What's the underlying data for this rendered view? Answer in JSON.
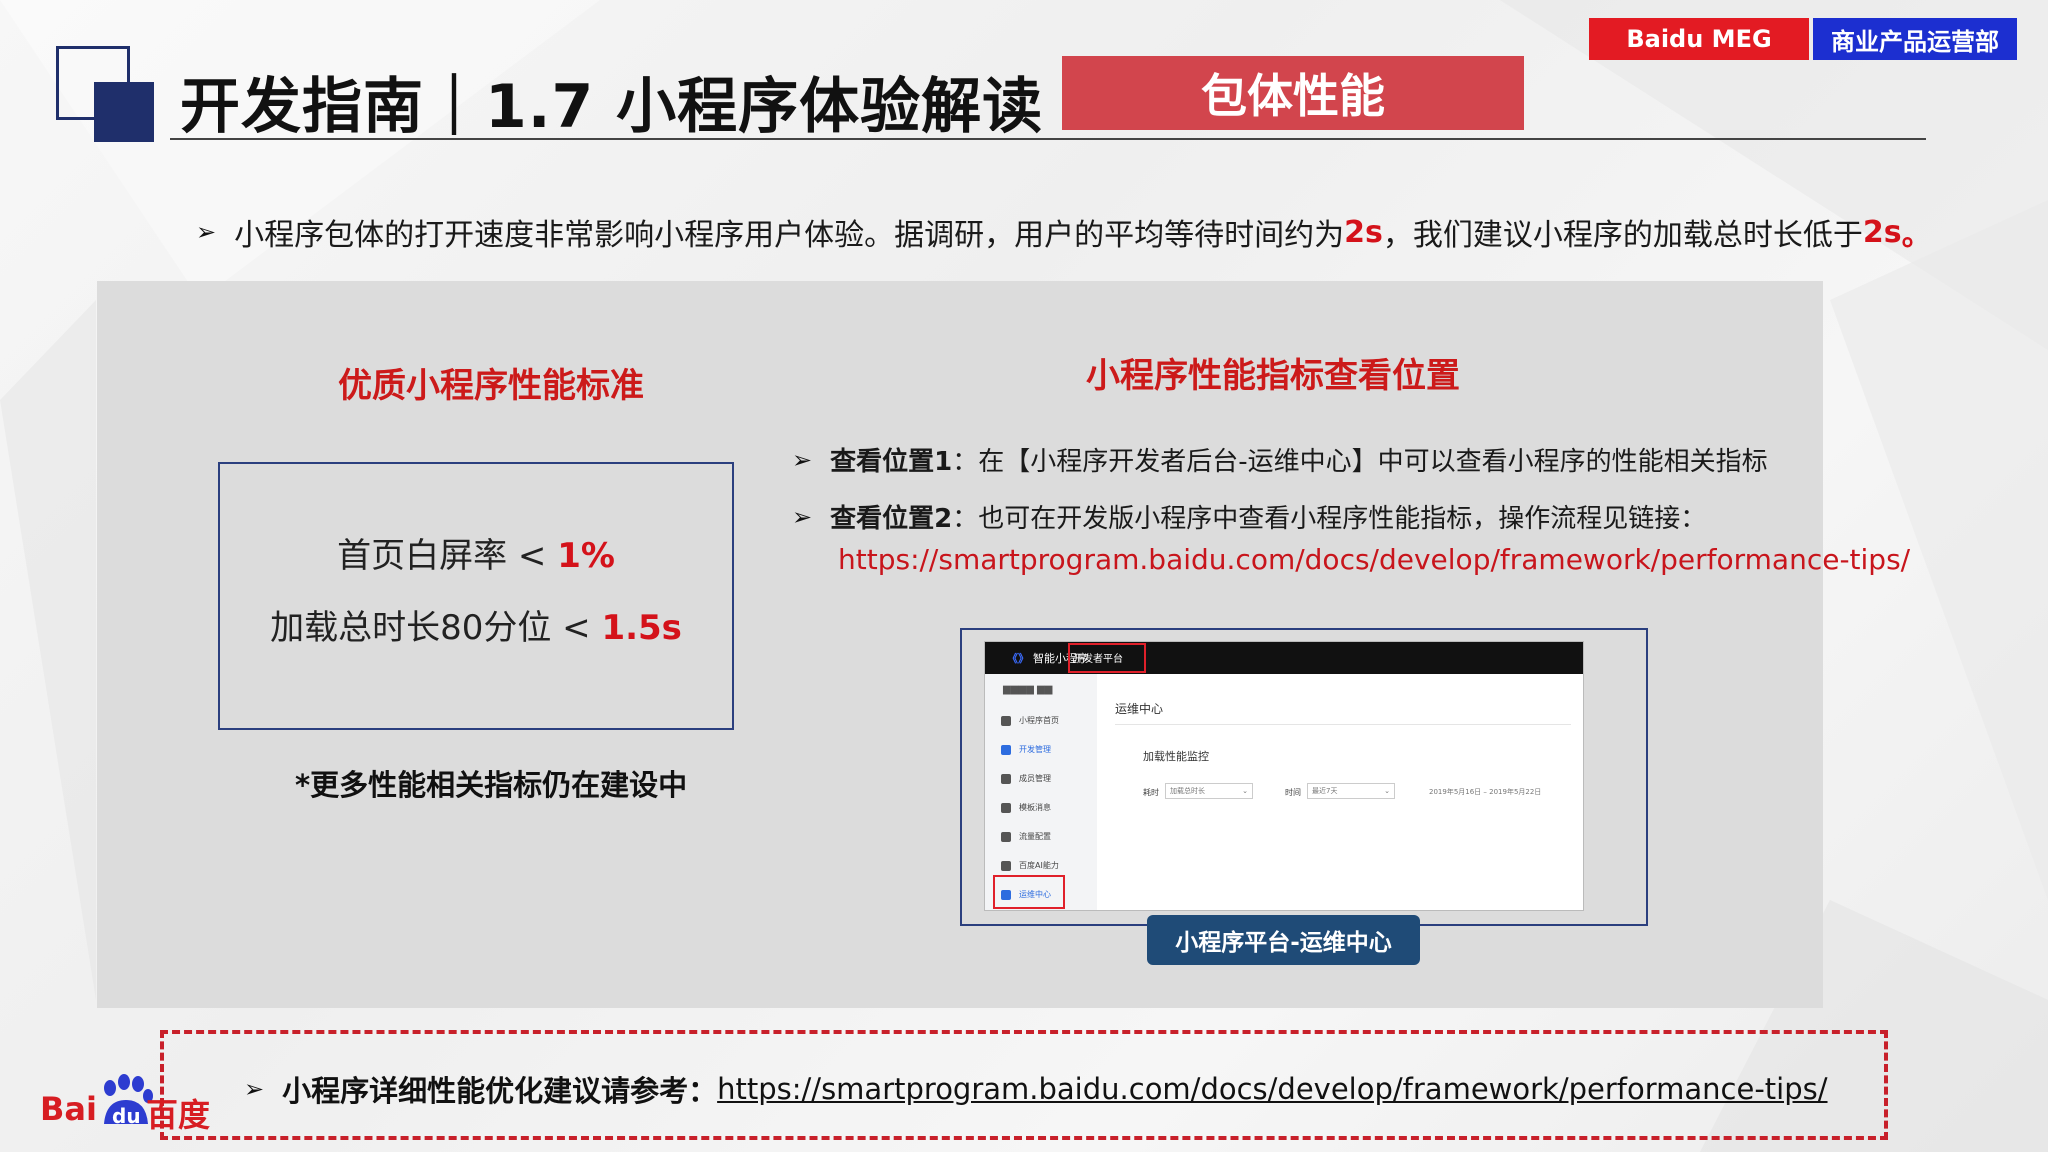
{
  "header": {
    "title": "开发指南｜1.7 小程序体验解读",
    "section_tag": "包体性能",
    "badge_meg": "Baidu MEG",
    "badge_dept": "商业产品运营部"
  },
  "intro": {
    "text_a": "小程序包体的打开速度非常影响小程序用户体验。据调研，用户的平均等待时间约为",
    "value_a": "2s",
    "text_b": "，我们建议小程序的加载总时长低于",
    "value_b": "2s",
    "text_c": "。"
  },
  "left": {
    "heading": "优质小程序性能标准",
    "line1_label": "首页白屏率 < ",
    "line1_value": "1%",
    "line2_label": "加载总时长80分位 < ",
    "line2_value": "1.5s",
    "note": "*更多性能相关指标仍在建设中"
  },
  "right": {
    "heading": "小程序性能指标查看位置",
    "loc1_label": "查看位置1",
    "loc1_text": "：在【小程序开发者后台-运维中心】中可以查看小程序的性能相关指标",
    "loc2_label": "查看位置2",
    "loc2_text": "：也可在开发版小程序中查看小程序性能指标，操作流程见链接：",
    "loc2_link": "https://smartprogram.baidu.com/docs/develop/framework/performance-tips/"
  },
  "screenshot": {
    "brand": "智能小程序",
    "platform": "开发者平台",
    "user": "▆▆▆▆ ▆▆",
    "sidebar": [
      "小程序首页",
      "开发管理",
      "成员管理",
      "模板消息",
      "流量配置",
      "百度AI能力",
      "运维中心"
    ],
    "sidebar_active": [
      1,
      6
    ],
    "main_title": "运维中心",
    "card_title": "加载性能监控",
    "field1_label": "耗时",
    "field1_value": "加载总时长",
    "field2_label": "时间",
    "field2_value": "最近7天",
    "date_range": "2019年5月16日 – 2019年5月22日",
    "caption": "小程序平台-运维中心"
  },
  "bottom": {
    "label": "小程序详细性能优化建议请参考：",
    "link": "https://smartprogram.baidu.com/docs/develop/framework/performance-tips/"
  },
  "logo": {
    "text_left": "Bai",
    "text_paw": "du",
    "text_right": "百度"
  },
  "colors": {
    "accent_red": "#d4121a",
    "navy": "#1f2f6b",
    "tag_red": "#d2454d",
    "badge_red": "#e31b23",
    "badge_blue": "#1c2fd0",
    "caption_blue": "#1f4b77"
  }
}
